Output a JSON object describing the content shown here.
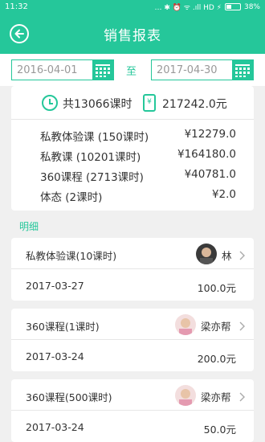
{
  "status_bar": {
    "time": "11:32",
    "icons": "… ✱ ⏰ ᯤ .ıll HD ⚡",
    "battery_text": "38%",
    "battery_level": 0.38
  },
  "header": {
    "title": "销售报表",
    "back_icon": "back-arrow-circle-icon"
  },
  "date_range": {
    "start": "2016-04-01",
    "separator": "至",
    "end": "2017-04-30",
    "calendar_icon": "calendar-icon"
  },
  "summary": {
    "total_hours": "共13066课时",
    "total_amount": "217242.0元",
    "hours_icon": "clock-icon",
    "amount_icon": "yuan-tag-icon",
    "categories": [
      {
        "label": "私教体验课 (150课时)",
        "amount": "¥12279.0"
      },
      {
        "label": "私教课 (10201课时)",
        "amount": "¥164180.0"
      },
      {
        "label": "360课程 (2713课时)",
        "amount": "¥40781.0"
      },
      {
        "label": "体态 (2课时)",
        "amount": "¥2.0"
      }
    ]
  },
  "detail_heading": "明细",
  "records": [
    {
      "course": "私教体验课(10课时)",
      "coach": "林",
      "date": "2017-03-27",
      "amount": "100.0元",
      "avatar_color": "#3a3a3a"
    },
    {
      "course": "360课程(1课时)",
      "coach": "梁亦帮",
      "date": "2017-03-24",
      "amount": "200.0元",
      "avatar_color": "#e8b9b9"
    },
    {
      "course": "360课程(500课时)",
      "coach": "梁亦帮",
      "date": "2017-03-24",
      "amount": "50.0元",
      "avatar_color": "#e8b9b9"
    }
  ],
  "colors": {
    "accent": "#25c79a",
    "background": "#f0f0f0"
  }
}
